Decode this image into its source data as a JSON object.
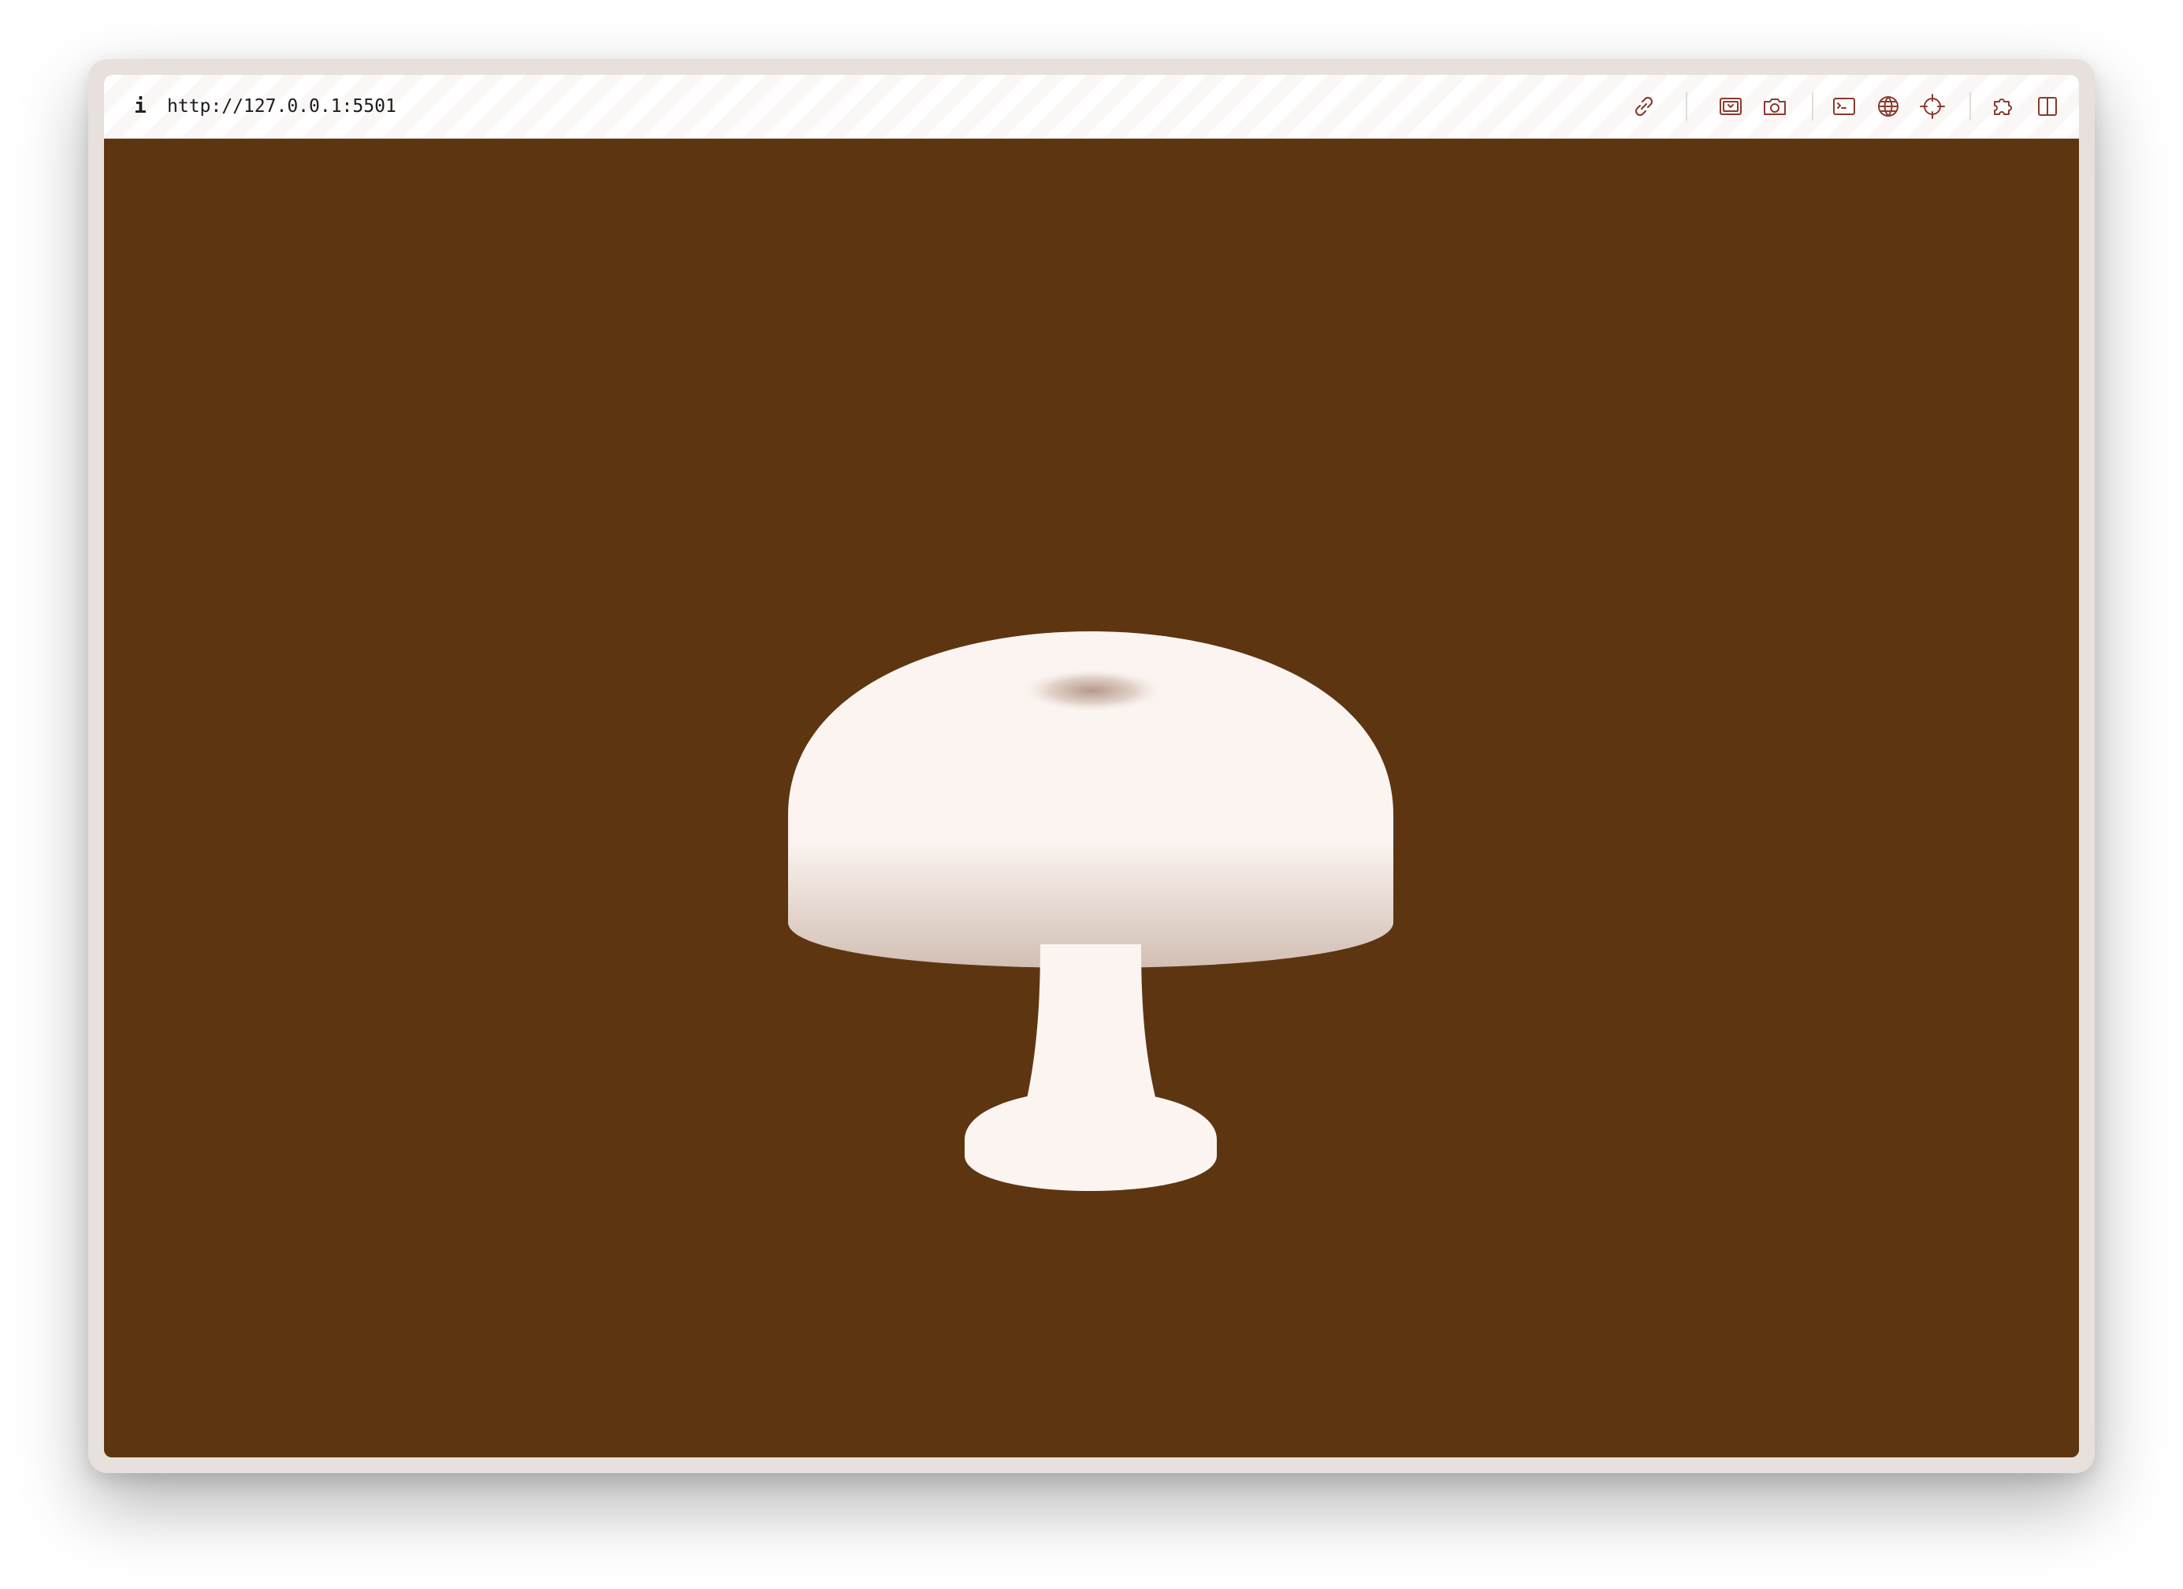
{
  "browser": {
    "info_icon_glyph": "i",
    "url": "http://127.0.0.1:5501",
    "toolbar_icons": [
      "link-icon",
      "screencast-icon",
      "camera-icon",
      "terminal-icon",
      "globe-icon",
      "crosshair-icon",
      "extensions-icon",
      "split-view-icon"
    ]
  },
  "colors": {
    "accent": "#8b3a2b",
    "background": "#5d3611",
    "lamp": "#fbf4f0",
    "lamp_shade": "#d2bfb4"
  },
  "content": {
    "object": "mushroom-lamp"
  }
}
